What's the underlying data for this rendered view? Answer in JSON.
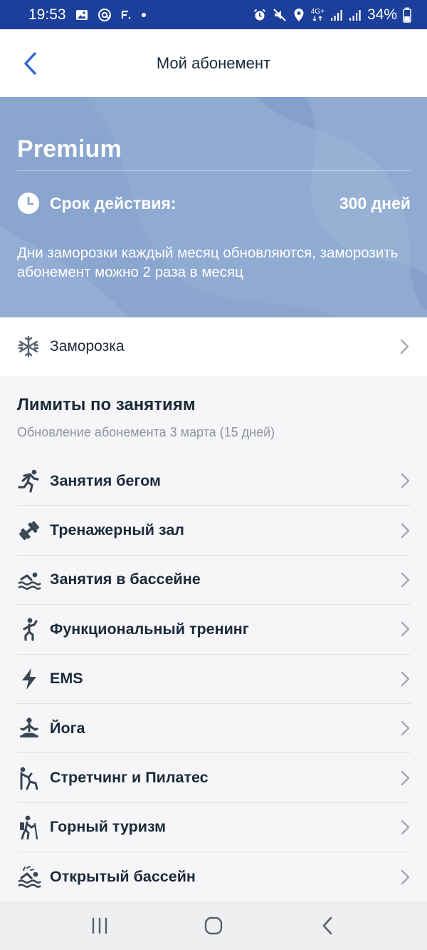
{
  "status_bar": {
    "time": "19:53",
    "battery": "34%",
    "left_icons": [
      "gallery-icon",
      "at-icon",
      "f-icon",
      "dot-icon"
    ],
    "right_icons": [
      "alarm-icon",
      "mute-icon",
      "location-icon",
      "4g-icon",
      "signal-icon",
      "signal-icon",
      "battery-icon"
    ],
    "network_label": "4G+"
  },
  "header": {
    "title": "Мой абонемент",
    "back_icon": "chevron-left-icon"
  },
  "banner": {
    "plan_name": "Premium",
    "validity_label": "Срок действия:",
    "validity_value": "300 дней",
    "note": "Дни заморозки каждый месяц обновляются, заморозить абонемент можно 2 раза в месяц",
    "colors": {
      "background": "#8aa5ce",
      "text": "#ffffff"
    }
  },
  "freeze": {
    "label": "Заморозка",
    "icon": "snowflake-icon"
  },
  "limits": {
    "title": "Лимиты по занятиям",
    "subtitle": "Обновление абонемента 3 марта (15 дней)",
    "items": [
      {
        "label": "Занятия бегом",
        "icon": "running-icon"
      },
      {
        "label": "Тренажерный зал",
        "icon": "dumbbell-icon"
      },
      {
        "label": "Занятия в бассейне",
        "icon": "swimming-icon"
      },
      {
        "label": "Функциональный тренинг",
        "icon": "functional-training-icon"
      },
      {
        "label": "EMS",
        "icon": "lightning-icon"
      },
      {
        "label": "Йога",
        "icon": "yoga-icon"
      },
      {
        "label": "Стретчинг и Пилатес",
        "icon": "stretching-icon"
      },
      {
        "label": "Горный туризм",
        "icon": "hiking-icon"
      },
      {
        "label": "Открытый бассейн",
        "icon": "open-pool-icon"
      }
    ]
  },
  "nav_bar": {
    "buttons": [
      "recent-apps-icon",
      "home-icon",
      "back-icon"
    ]
  },
  "colors": {
    "status_bar": "#1b3f9a",
    "accent": "#2f66d0",
    "text_primary": "#1b2a3a",
    "text_secondary": "#8b93a0",
    "icon_gray": "#3a4654"
  }
}
